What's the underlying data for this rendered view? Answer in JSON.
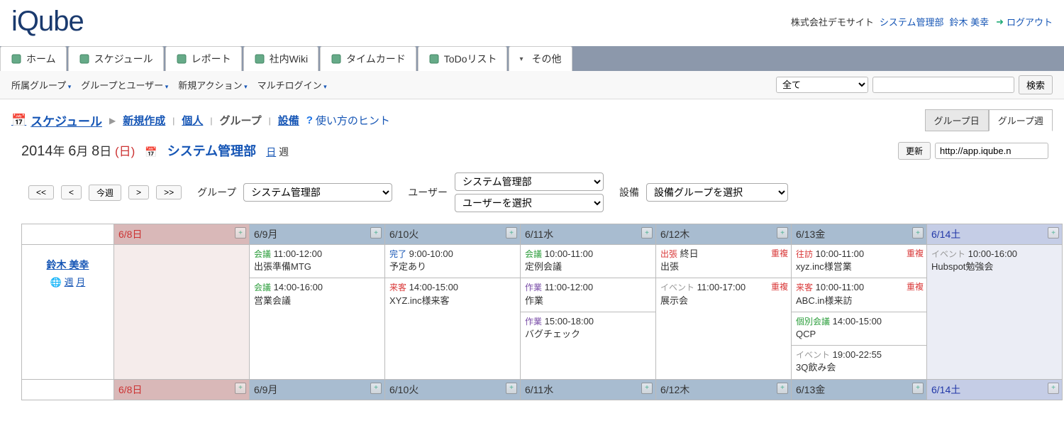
{
  "header": {
    "logo": "iQube",
    "company": "株式会社デモサイト",
    "dept_link": "システム管理部",
    "user": "鈴木 美幸",
    "logout": "ログアウト"
  },
  "nav": [
    {
      "label": "ホーム",
      "icon": "home-icon"
    },
    {
      "label": "スケジュール",
      "icon": "schedule-icon"
    },
    {
      "label": "レポート",
      "icon": "report-icon"
    },
    {
      "label": "社内Wiki",
      "icon": "wiki-icon"
    },
    {
      "label": "タイムカード",
      "icon": "timecard-icon"
    },
    {
      "label": "ToDoリスト",
      "icon": "todo-icon"
    },
    {
      "label": "その他",
      "icon": "other-icon"
    }
  ],
  "subnav": {
    "items": [
      "所属グループ",
      "グループとユーザー",
      "新規アクション",
      "マルチログイン"
    ],
    "filter_select": "全て",
    "search_btn": "検索"
  },
  "sched_nav": {
    "title": "スケジュール",
    "new": "新規作成",
    "personal": "個人",
    "group": "グループ",
    "facility": "設備",
    "hint": "使い方のヒント",
    "tab_day": "グループ日",
    "tab_week": "グループ週"
  },
  "date_row": {
    "year": "2014",
    "yl": "年",
    "month": "6",
    "ml": "月",
    "day": "8",
    "dl": "日",
    "wday": "(日)",
    "dept": "システム管理部",
    "day_link": "日",
    "week_link": "週",
    "update_btn": "更新",
    "url": "http://app.iqube.n"
  },
  "controls": {
    "prev2": "<<",
    "prev": "<",
    "today": "今週",
    "next": ">",
    "next2": ">>",
    "group_label": "グループ",
    "group_select": "システム管理部",
    "user_label": "ユーザー",
    "user_select1": "システム管理部",
    "user_select2": "ユーザーを選択",
    "facility_label": "設備",
    "facility_select": "設備グループを選択"
  },
  "calendar": {
    "days": [
      {
        "label": "6/8日",
        "cls": "sun"
      },
      {
        "label": "6/9月",
        "cls": ""
      },
      {
        "label": "6/10火",
        "cls": ""
      },
      {
        "label": "6/11水",
        "cls": ""
      },
      {
        "label": "6/12木",
        "cls": ""
      },
      {
        "label": "6/13金",
        "cls": ""
      },
      {
        "label": "6/14土",
        "cls": "sat"
      }
    ],
    "user": {
      "name": "鈴木 美幸",
      "week": "週",
      "month": "月"
    },
    "events": [
      [],
      [
        {
          "tag": "会議",
          "tagcls": "meeting",
          "time": "11:00-12:00",
          "title": "出張準備MTG"
        },
        {
          "tag": "会議",
          "tagcls": "meeting",
          "time": "14:00-16:00",
          "title": "営業会議"
        }
      ],
      [
        {
          "tag": "完了",
          "tagcls": "done",
          "time": "9:00-10:00",
          "title": "予定あり"
        },
        {
          "tag": "来客",
          "tagcls": "visitor",
          "time": "14:00-15:00",
          "title": "XYZ.inc様来客"
        }
      ],
      [
        {
          "tag": "会議",
          "tagcls": "meeting",
          "time": "10:00-11:00",
          "title": "定例会議"
        },
        {
          "tag": "作業",
          "tagcls": "work",
          "time": "11:00-12:00",
          "title": "作業"
        },
        {
          "tag": "作業",
          "tagcls": "work",
          "time": "15:00-18:00",
          "title": "バグチェック"
        }
      ],
      [
        {
          "tag": "出張",
          "tagcls": "trip",
          "time": "終日",
          "title": "出張",
          "dup": "重複"
        },
        {
          "tag": "イベント",
          "tagcls": "evt",
          "time": "11:00-17:00",
          "title": "展示会",
          "dup": "重複"
        }
      ],
      [
        {
          "tag": "往訪",
          "tagcls": "ivisit",
          "time": "10:00-11:00",
          "title": "xyz.inc様営業",
          "dup": "重複"
        },
        {
          "tag": "来客",
          "tagcls": "visitor",
          "time": "10:00-11:00",
          "title": "ABC.in様来訪",
          "dup": "重複"
        },
        {
          "tag": "個別会議",
          "tagcls": "indmtg",
          "time": "14:00-15:00",
          "title": "QCP"
        },
        {
          "tag": "イベント",
          "tagcls": "evt",
          "time": "19:00-22:55",
          "title": "3Q飲み会"
        }
      ],
      [
        {
          "tag": "イベント",
          "tagcls": "evt",
          "time": "10:00-16:00",
          "title": "Hubspot勉強会"
        }
      ]
    ]
  }
}
